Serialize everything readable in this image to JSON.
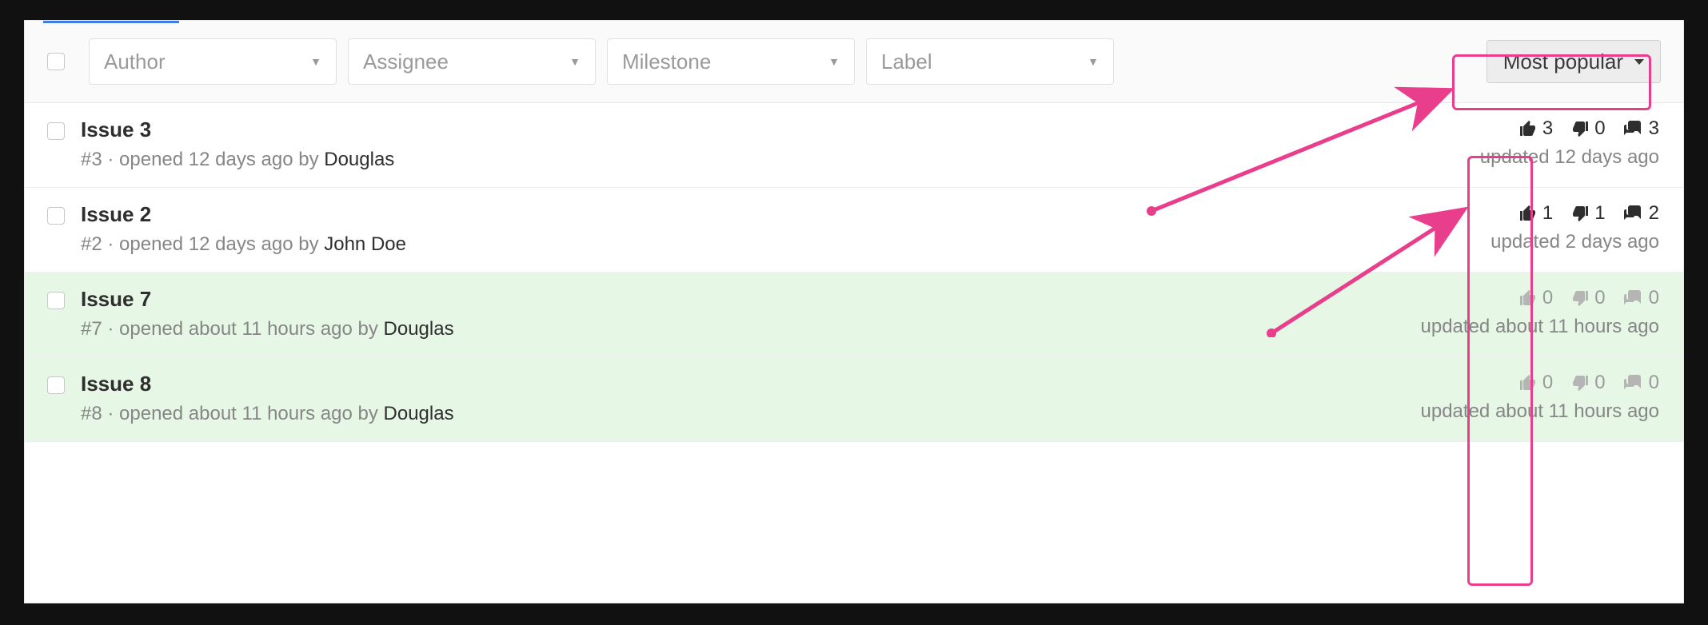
{
  "filters": {
    "author": "Author",
    "assignee": "Assignee",
    "milestone": "Milestone",
    "label": "Label"
  },
  "sort": {
    "label": "Most popular"
  },
  "issues": [
    {
      "title": "Issue 3",
      "num_prefix": "#3 · opened 12 days ago by ",
      "author": "Douglas",
      "up": "3",
      "down": "0",
      "comments": "3",
      "updated": "updated 12 days ago",
      "muted": false,
      "up_muted": false,
      "down_muted": false
    },
    {
      "title": "Issue 2",
      "num_prefix": "#2 · opened 12 days ago by ",
      "author": "John Doe",
      "up": "1",
      "down": "1",
      "comments": "2",
      "updated": "updated 2 days ago",
      "muted": false,
      "up_muted": false,
      "down_muted": false
    },
    {
      "title": "Issue 7",
      "num_prefix": "#7 · opened about 11 hours ago by ",
      "author": "Douglas",
      "up": "0",
      "down": "0",
      "comments": "0",
      "updated": "updated about 11 hours ago",
      "muted": true,
      "up_muted": true,
      "down_muted": true
    },
    {
      "title": "Issue 8",
      "num_prefix": "#8 · opened about 11 hours ago by ",
      "author": "Douglas",
      "up": "0",
      "down": "0",
      "comments": "0",
      "updated": "updated about 11 hours ago",
      "muted": true,
      "up_muted": true,
      "down_muted": true
    }
  ]
}
